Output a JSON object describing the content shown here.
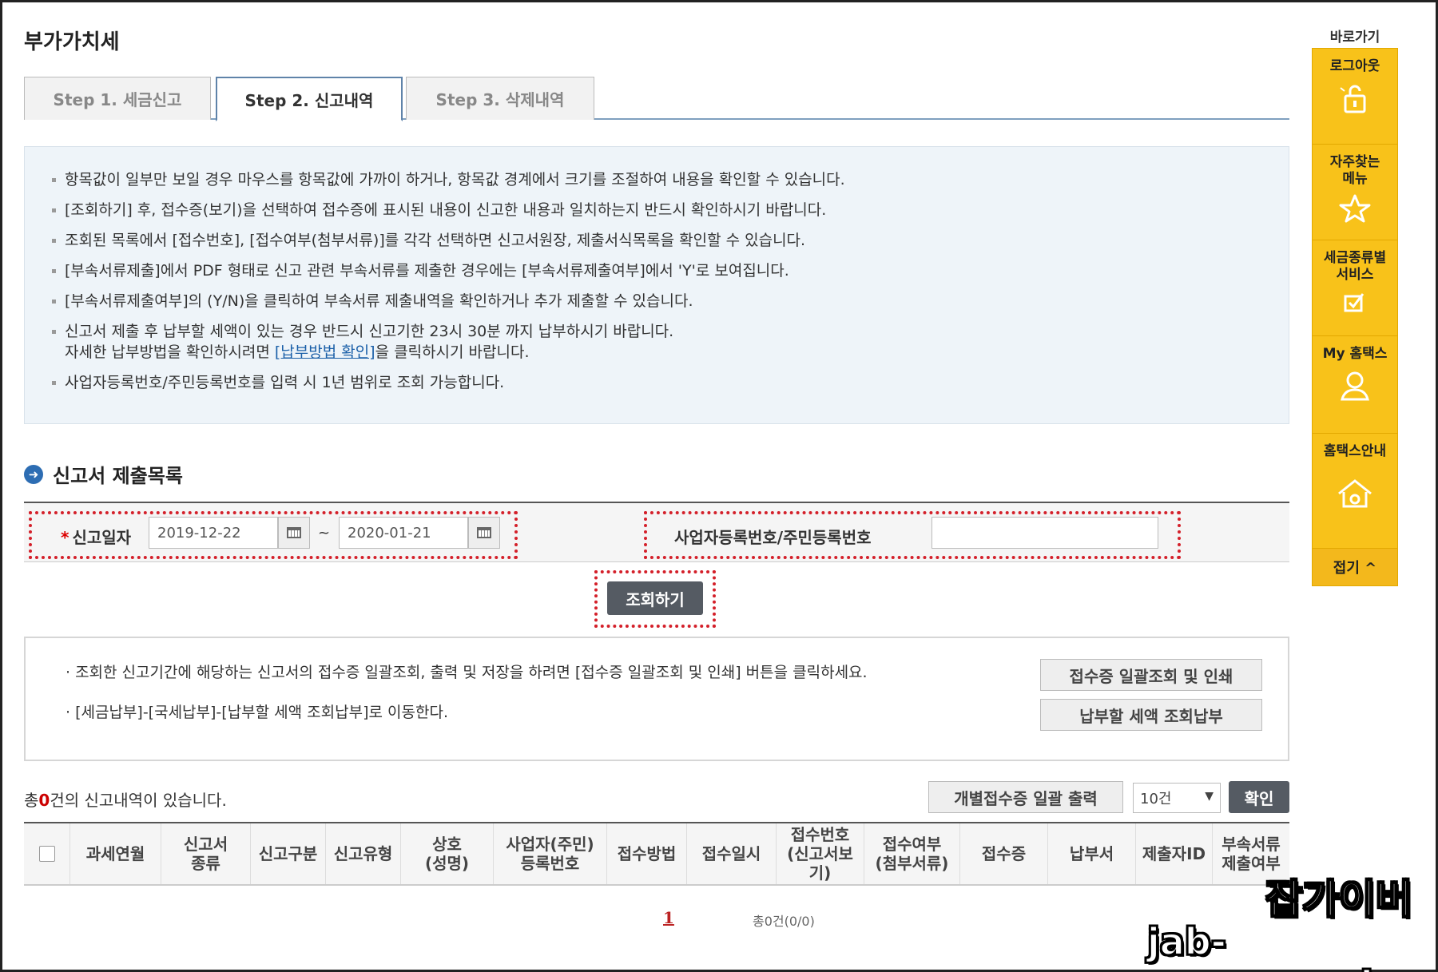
{
  "page": {
    "title": "부가가치세"
  },
  "tabs": [
    {
      "label": "Step 1. 세금신고",
      "active": false
    },
    {
      "label": "Step 2. 신고내역",
      "active": true
    },
    {
      "label": "Step 3. 삭제내역",
      "active": false
    }
  ],
  "notice": {
    "items": [
      "항목값이 일부만 보일 경우 마우스를 항목값에 가까이 하거나, 항목값 경계에서 크기를 조절하여 내용을 확인할 수 있습니다.",
      "[조회하기] 후, 접수증(보기)을 선택하여 접수증에 표시된 내용이 신고한 내용과 일치하는지 반드시 확인하시기 바랍니다.",
      "조회된 목록에서 [접수번호], [접수여부(첨부서류)]를 각각 선택하면 신고서원장, 제출서식목록을 확인할 수 있습니다.",
      "[부속서류제출]에서 PDF 형태로 신고 관련 부속서류를 제출한 경우에는 [부속서류제출여부]에서 'Y'로 보여집니다.",
      "[부속서류제출여부]의 (Y/N)을 클릭하여 부속서류 제출내역을 확인하거나 추가 제출할 수 있습니다.",
      "신고서 제출 후 납부할 세액이 있는 경우 반드시 신고기한 23시 30분 까지 납부하시기 바랍니다."
    ],
    "payment_line": {
      "prefix": "자세한 납부방법을 확인하시려면 ",
      "link": "[납부방법 확인]",
      "suffix": "을 클릭하시기 바랍니다."
    },
    "last_item": "사업자등록번호/주민등록번호를 입력 시 1년 범위로 조회 가능합니다."
  },
  "section": {
    "title": "신고서 제출목록",
    "icon": "arrow-circle-icon"
  },
  "search": {
    "date_label": "신고일자",
    "required_mark": "*",
    "date_from": "2019-12-22",
    "date_to": "2020-01-21",
    "separator": "~",
    "biz_label": "사업자등록번호/주민등록번호",
    "biz_value": "",
    "query_button": "조회하기"
  },
  "info": {
    "line1": "· 조회한 신고기간에 해당하는 신고서의 접수증 일괄조회, 출력 및 저장을 하려면 [접수증 일괄조회 및 인쇄] 버튼을 클릭하세요.",
    "line2": "· [세금납부]-[국세납부]-[납부할 세액 조회납부]로 이동한다.",
    "button1": "접수증 일괄조회 및 인쇄",
    "button2": "납부할 세액 조회납부"
  },
  "list": {
    "count_prefix": "총",
    "count": "0",
    "count_suffix": "건의 신고내역이 있습니다.",
    "batch_button": "개별접수증 일괄 출력",
    "page_size": "10건",
    "confirm_button": "확인",
    "columns": [
      "과세연월",
      "신고서\n종류",
      "신고구분",
      "신고유형",
      "상호\n(성명)",
      "사업자(주민)\n등록번호",
      "접수방법",
      "접수일시",
      "접수번호\n(신고서보기)",
      "접수여부\n(첨부서류)",
      "접수증",
      "납부서",
      "제출자ID",
      "부속서류\n제출여부"
    ]
  },
  "pagination": {
    "current": "1",
    "total": "총0건(0/0)"
  },
  "quickbar": {
    "title": "바로가기",
    "items": [
      {
        "label": "로그아웃",
        "icon": "lock-icon"
      },
      {
        "label": "자주찾는\n메뉴",
        "icon": "star-icon"
      },
      {
        "label": "세금종류별\n서비스",
        "icon": "checkbox-icon"
      },
      {
        "label": "My 홈택스",
        "icon": "user-icon"
      },
      {
        "label": "홈택스안내",
        "icon": "home-info-icon"
      }
    ],
    "fold": "접기 ^"
  },
  "watermark": {
    "line1": "잡가이버",
    "line2": "jab-guyver.co.kr"
  }
}
